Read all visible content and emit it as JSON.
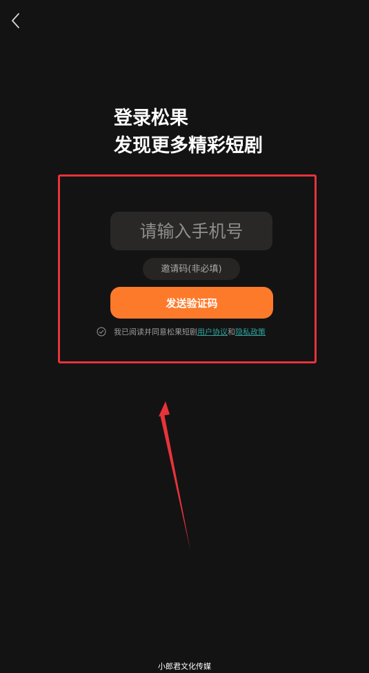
{
  "header": {
    "back_icon": "chevron-left-icon"
  },
  "headline": {
    "line1": "登录松果",
    "line2": "发现更多精彩短剧"
  },
  "form": {
    "phone_placeholder": "请输入手机号",
    "invite_placeholder": "邀请码(非必填)",
    "send_button_label": "发送验证码"
  },
  "agreement": {
    "check_icon": "check-circle-icon",
    "prefix": "我已阅读并同意松果短剧",
    "user_agreement": "用户协议",
    "and": "和",
    "privacy_policy": "隐私政策"
  },
  "watermark": "小郎君文化传媒",
  "colors": {
    "background": "#131313",
    "accent": "#fe7a2b",
    "link": "#2fa39a",
    "annotation_red": "#e8333a"
  }
}
